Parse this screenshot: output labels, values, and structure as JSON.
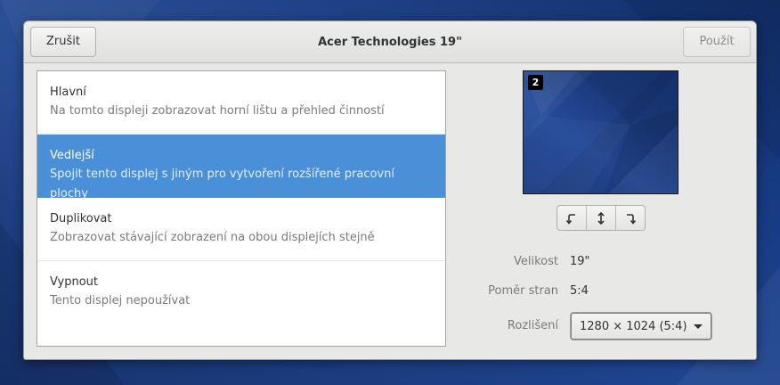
{
  "header": {
    "cancel_label": "Zrušit",
    "title": "Acer Technologies 19\"",
    "apply_label": "Použít"
  },
  "modes": [
    {
      "title": "Hlavní",
      "subtitle": "Na tomto displeji zobrazovat horní lištu a přehled činností",
      "selected": false
    },
    {
      "title": "Vedlejší",
      "subtitle": "Spojit tento displej s jiným pro vytvoření rozšířené pracovní plochy",
      "selected": true
    },
    {
      "title": "Duplikovat",
      "subtitle": "Zobrazovat stávající zobrazení na obou displejích stejně",
      "selected": false
    },
    {
      "title": "Vypnout",
      "subtitle": "Tento displej nepoužívat",
      "selected": false
    }
  ],
  "preview": {
    "badge": "2"
  },
  "rotation": {
    "icons": [
      "rotate-left-icon",
      "flip-vertical-icon",
      "rotate-right-icon"
    ]
  },
  "properties": {
    "size_label": "Velikost",
    "size_value": "19\"",
    "aspect_label": "Poměr stran",
    "aspect_value": "5:4",
    "resolution_label": "Rozlišení",
    "resolution_value": "1280 × 1024 (5:4)"
  },
  "colors": {
    "selection": "#4a90d9",
    "desktop_bg": "#1f4590"
  }
}
